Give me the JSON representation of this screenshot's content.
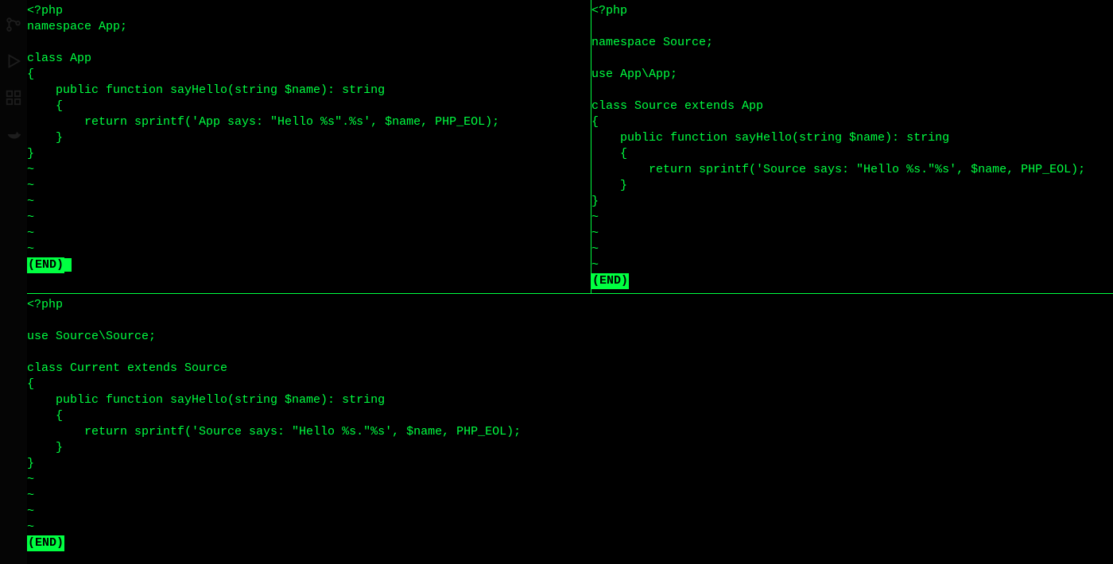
{
  "activity_bar": {
    "icons": [
      "branch-icon",
      "debug-icon",
      "extensions-icon",
      "docker-icon"
    ]
  },
  "panes": {
    "top_left": {
      "lines": [
        "<?php",
        "namespace App;",
        "",
        "class App",
        "{",
        "    public function sayHello(string $name): string",
        "    {",
        "        return sprintf('App says: \"Hello %s\".%s', $name, PHP_EOL);",
        "    }",
        "}"
      ],
      "tildes": [
        "~",
        "~",
        "~",
        "~",
        "~",
        "~"
      ],
      "end": "(END)"
    },
    "top_right": {
      "lines": [
        "<?php",
        "",
        "namespace Source;",
        "",
        "use App\\App;",
        "",
        "class Source extends App",
        "{",
        "    public function sayHello(string $name): string",
        "    {",
        "        return sprintf('Source says: \"Hello %s.\"%s', $name, PHP_EOL);",
        "    }",
        "}"
      ],
      "tildes": [
        "~",
        "~",
        "~",
        "~"
      ],
      "end": "(END)"
    },
    "bottom": {
      "lines": [
        "<?php",
        "",
        "use Source\\Source;",
        "",
        "class Current extends Source",
        "{",
        "    public function sayHello(string $name): string",
        "    {",
        "        return sprintf('Source says: \"Hello %s.\"%s', $name, PHP_EOL);",
        "    }",
        "}"
      ],
      "tildes": [
        "~",
        "~",
        "~",
        "~"
      ],
      "end": "(END)"
    }
  }
}
